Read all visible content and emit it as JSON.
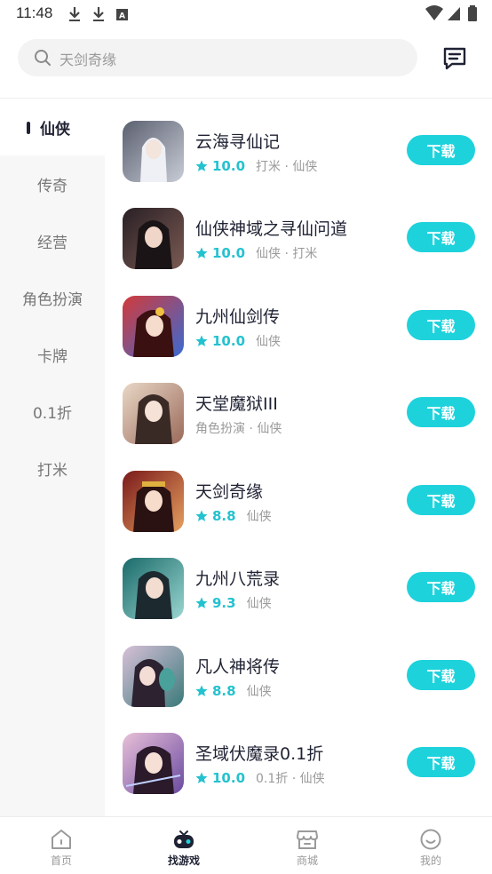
{
  "status_bar": {
    "time": "11:48"
  },
  "search": {
    "placeholder": "天剑奇缘"
  },
  "categories": [
    {
      "label": "仙侠",
      "active": true
    },
    {
      "label": "传奇",
      "active": false
    },
    {
      "label": "经营",
      "active": false
    },
    {
      "label": "角色扮演",
      "active": false
    },
    {
      "label": "卡牌",
      "active": false
    },
    {
      "label": "0.1折",
      "active": false
    },
    {
      "label": "打米",
      "active": false
    }
  ],
  "games": [
    {
      "name": "云海寻仙记",
      "rating": "10.0",
      "tags": "打米 · 仙侠",
      "button": "下载"
    },
    {
      "name": "仙侠神域之寻仙问道",
      "rating": "10.0",
      "tags": "仙侠 · 打米",
      "button": "下载"
    },
    {
      "name": "九州仙剑传",
      "rating": "10.0",
      "tags": "仙侠",
      "button": "下载"
    },
    {
      "name": "天堂魔狱III",
      "rating": "",
      "tags": "角色扮演 · 仙侠",
      "button": "下载"
    },
    {
      "name": "天剑奇缘",
      "rating": "8.8",
      "tags": "仙侠",
      "button": "下载"
    },
    {
      "name": "九州八荒录",
      "rating": "9.3",
      "tags": "仙侠",
      "button": "下载"
    },
    {
      "name": "凡人神将传",
      "rating": "8.8",
      "tags": "仙侠",
      "button": "下载"
    },
    {
      "name": "圣域伏魔录0.1折",
      "rating": "10.0",
      "tags": "0.1折 · 仙侠",
      "button": "下载"
    }
  ],
  "bottom_nav": [
    {
      "label": "首页",
      "icon": "home-icon",
      "active": false
    },
    {
      "label": "找游戏",
      "icon": "gamepad-icon",
      "active": true
    },
    {
      "label": "商城",
      "icon": "store-icon",
      "active": false
    },
    {
      "label": "我的",
      "icon": "smile-icon",
      "active": false
    }
  ],
  "colors": {
    "accent": "#1ed2dc",
    "rating": "#23c2d0",
    "text": "#1f2233",
    "muted": "#9a9a9a"
  }
}
